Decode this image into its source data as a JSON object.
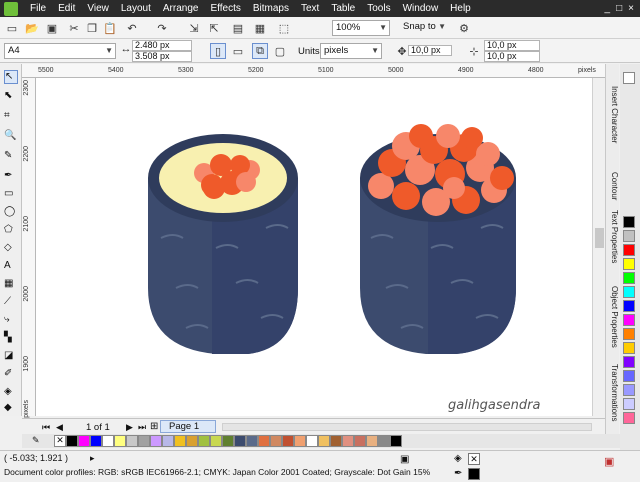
{
  "menu": {
    "items": [
      "File",
      "Edit",
      "View",
      "Layout",
      "Arrange",
      "Effects",
      "Bitmaps",
      "Text",
      "Table",
      "Tools",
      "Window",
      "Help"
    ],
    "window_controls": [
      "_",
      "□",
      "×"
    ]
  },
  "toolbar": {
    "zoom_value": "100%",
    "snap_to_label": "Snap to"
  },
  "property_bar": {
    "page_size": "A4",
    "width": "2.480 px",
    "height": "3.508 px",
    "units_label": "Units:",
    "units_value": "pixels",
    "nudge": "10,0 px",
    "dup_x": "10,0 px",
    "dup_y": "10,0 px"
  },
  "ruler": {
    "unit": "pixels",
    "h_labels": [
      "5500",
      "5400",
      "5300",
      "5200",
      "5100",
      "5000",
      "4900",
      "4800"
    ],
    "v_labels": [
      "2300",
      "2200",
      "2100",
      "2000",
      "1900"
    ]
  },
  "dockers": [
    "Insert Character",
    "Contour",
    "Text Properties",
    "Object Properties",
    "Transformations"
  ],
  "page_nav": {
    "current": "1 of 1",
    "page_tab": "Page 1"
  },
  "watermark": "galihgasendra",
  "status": {
    "coordinates": "( -5.033; 1.921 )",
    "color_profiles": "Document color profiles: RGB: sRGB IEC61966-2.1; CMYK: Japan Color 2001 Coated; Grayscale: Dot Gain 15%"
  },
  "colors": {
    "nori": "#3c4b6e",
    "nori_dark": "#2f3c5c",
    "rice": "#f8f0b0",
    "roe_dark": "#ef5a2a",
    "roe_light": "#f7876a"
  },
  "palette_v": [
    "#ffffff",
    "#000000",
    "#c0c0c0",
    "#808080",
    "#ff0000",
    "#ffff00",
    "#00ff00",
    "#00ffff",
    "#0000ff",
    "#ff00ff",
    "#ff8000",
    "#ffcc00",
    "#8000ff",
    "#6666ff",
    "#9999ff",
    "#ccccff",
    "#ff6699",
    "#66ccff"
  ],
  "palette_h": [
    "#000000",
    "#ff00ff",
    "#0000ff",
    "#ffffff",
    "#ffff80",
    "#c8c8c8",
    "#a0a0a0",
    "#cc99ff",
    "#b8b8e8",
    "#f0c020",
    "#d8a030",
    "#a0c040",
    "#c8d850",
    "#608030",
    "#3c4b6e",
    "#5a6a8a",
    "#e07040",
    "#d08860",
    "#c05030",
    "#f0a070",
    "#ffffff",
    "#f0c060",
    "#a06030",
    "#e09080",
    "#c87060",
    "#e8b080",
    "#888888",
    "#000000"
  ]
}
